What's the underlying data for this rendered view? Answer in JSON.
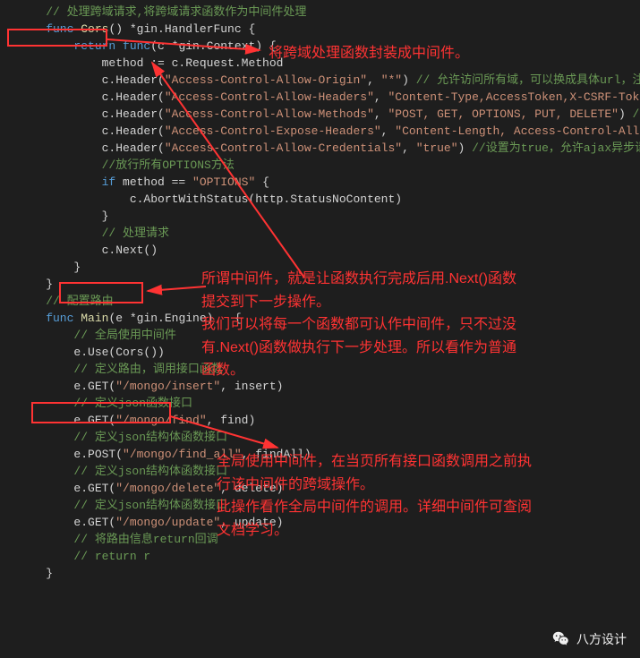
{
  "code": {
    "l1": "    // 处理跨域请求,将跨域请求函数作为中间件处理",
    "l2_func": "    func",
    "l2_name": " Cors",
    "l2_rest": "() *gin.HandlerFunc {",
    "l3_ret": "        return",
    "l3_func": " func",
    "l3_rest": "(c *gin.Context) {",
    "l4": "            method := c.Request.Method",
    "l5": "",
    "l6a": "            c.Header(",
    "l6s1": "\"Access-Control-Allow-Origin\"",
    "l6m": ", ",
    "l6s2": "\"*\"",
    "l6e": ") ",
    "l6c": "// 允许访问所有域，可以换成具体url，注意",
    "l7a": "            c.Header(",
    "l7s1": "\"Access-Control-Allow-Headers\"",
    "l7m": ", ",
    "l7s2": "\"Content-Type,AccessToken,X-CSRF-Token,",
    "l8a": "            c.Header(",
    "l8s1": "\"Access-Control-Allow-Methods\"",
    "l8m": ", ",
    "l8s2": "\"POST, GET, OPTIONS, PUT, DELETE\"",
    "l8e": ") ",
    "l8c": "//允许",
    "l9a": "            c.Header(",
    "l9s1": "\"Access-Control-Expose-Headers\"",
    "l9m": ", ",
    "l9s2": "\"Content-Length, Access-Control-Allow-O",
    "l10a": "            c.Header(",
    "l10s1": "\"Access-Control-Allow-Credentials\"",
    "l10m": ", ",
    "l10s2": "\"true\"",
    "l10e": ") ",
    "l10c": "//设置为true，允许ajax异步请求",
    "l11": "",
    "l12c": "            //放行所有OPTIONS方法",
    "l13a": "            if",
    "l13b": " method == ",
    "l13s": "\"OPTIONS\"",
    "l13e": " {",
    "l14a": "                c.AbortWithStatus(http.StatusNoContent)",
    "l15": "            }",
    "l16c": "            // 处理请求",
    "l17": "            c.Next()",
    "l18": "        }",
    "l19": "    }",
    "l20": "",
    "l21c": "    // 配置路由",
    "l22a": "    func",
    "l22b": " Main",
    "l22c": "(e *gin.Engine)   {",
    "l23c": "        // 全局使用中间件",
    "l24": "        e.Use(Cors())",
    "l25c": "        // 定义路由，调用接口函数",
    "l26a": "        e.GET(",
    "l26s": "\"/mongo/insert\"",
    "l26e": ", insert)",
    "l27c": "        // 定义json函数接口",
    "l28a": "        e.GET(",
    "l28s": "\"/mongo/find\"",
    "l28e": ", find)",
    "l29c": "        // 定义json结构体函数接口",
    "l30a": "        e.POST(",
    "l30s": "\"/mongo/find_all\"",
    "l30e": ", findAll)",
    "l31c": "        // 定义json结构体函数接口",
    "l32a": "        e.GET(",
    "l32s": "\"/mongo/delete\"",
    "l32e": ", delete)",
    "l33c": "        // 定义json结构体函数接口",
    "l34a": "        e.GET(",
    "l34s": "\"/mongo/update\"",
    "l34e": ", update)",
    "l35c": "        // 将路由信息return回调",
    "l36c": "        // return r",
    "l37": "    }"
  },
  "annotations": {
    "a1": "将跨域处理函数封装成中间件。",
    "a2_l1": "所谓中间件，就是让函数执行完成后用.Next()函数",
    "a2_l2": "提交到下一步操作。",
    "a2_l3": "我们可以将每一个函数都可认作中间件，只不过没",
    "a2_l4": "有.Next()函数做执行下一步处理。所以看作为普通",
    "a2_l5": "函数。",
    "a3_l1": "全局使用中间件，在当页所有接口函数调用之前执",
    "a3_l2": "行该中间件的跨域操作。",
    "a3_l3": "此操作看作全局中间件的调用。详细中间件可查阅",
    "a3_l4": "文档学习。"
  },
  "watermark": {
    "text": "八方设计"
  }
}
